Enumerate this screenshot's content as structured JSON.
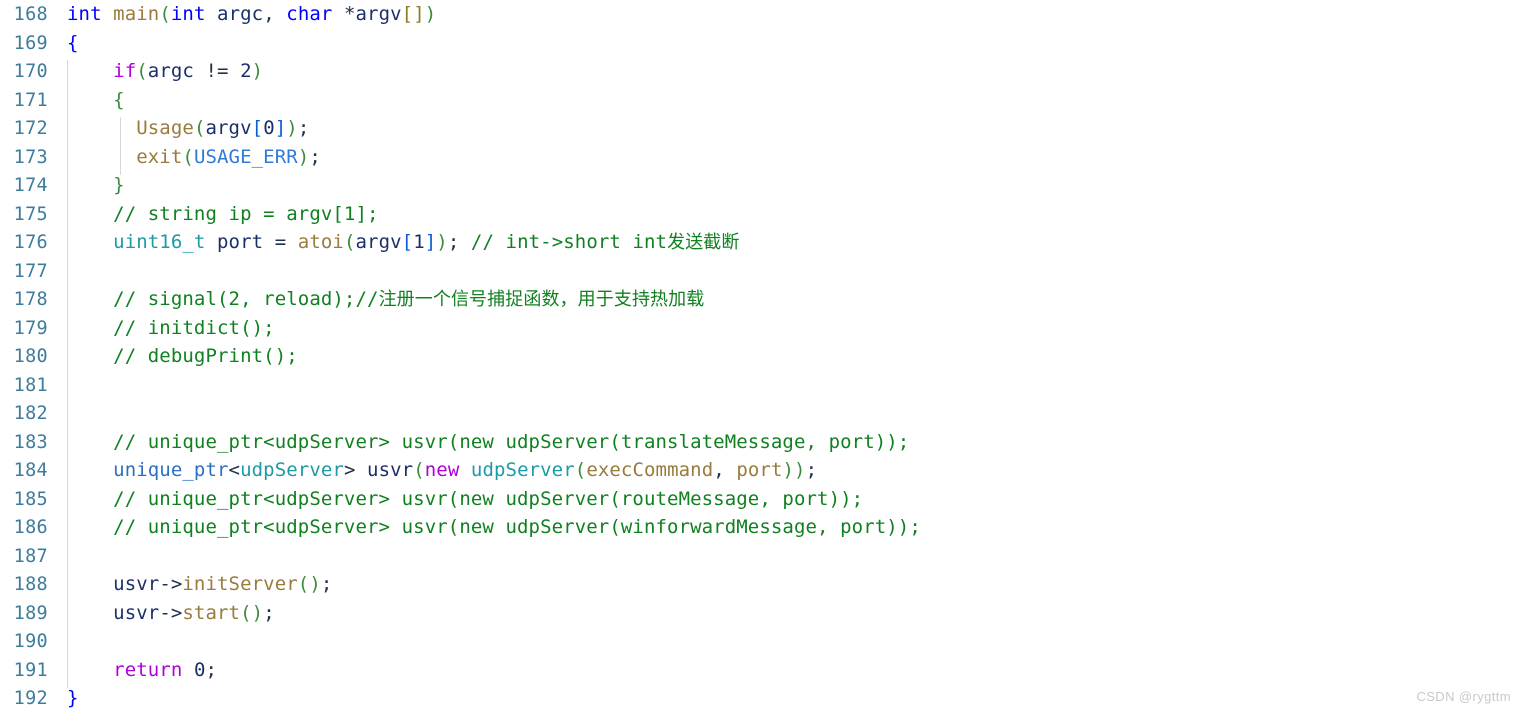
{
  "editor": {
    "language": "cpp",
    "watermark": "CSDN @rygttm",
    "first_line_number": 168,
    "last_line_number": 192,
    "colors": {
      "background": "#ffffff",
      "line_number": "#3f7c9c",
      "keyword": "#0000ff",
      "control_keyword": "#af00db",
      "function": "#977c3c",
      "variable": "#1a2f6b",
      "type": "#1c9aa6",
      "class": "#2b6fc4",
      "macro": "#2f7bd6",
      "comment": "#108020",
      "paren": "#3d8b3d",
      "bracket": "#0b5ed7",
      "brace": "#0000ff",
      "punctuation": "#20304a",
      "indent_guide": "#d8d8d8",
      "watermark": "#c9c9c9"
    }
  },
  "lines": [
    {
      "n": "168",
      "text": "int main(int argc, char *argv[])"
    },
    {
      "n": "169",
      "text": "{"
    },
    {
      "n": "170",
      "text": "    if(argc != 2)"
    },
    {
      "n": "171",
      "text": "    {"
    },
    {
      "n": "172",
      "text": "        Usage(argv[0]);"
    },
    {
      "n": "173",
      "text": "        exit(USAGE_ERR);"
    },
    {
      "n": "174",
      "text": "    }"
    },
    {
      "n": "175",
      "text": "    // string ip = argv[1];"
    },
    {
      "n": "176",
      "text": "    uint16_t port = atoi(argv[1]); // int->short int发送截断"
    },
    {
      "n": "177",
      "text": ""
    },
    {
      "n": "178",
      "text": "    // signal(2, reload);//注册一个信号捕捉函数，用于支持热加载"
    },
    {
      "n": "179",
      "text": "    // initdict();"
    },
    {
      "n": "180",
      "text": "    // debugPrint();"
    },
    {
      "n": "181",
      "text": ""
    },
    {
      "n": "182",
      "text": ""
    },
    {
      "n": "183",
      "text": "    // unique_ptr<udpServer> usvr(new udpServer(translateMessage, port));"
    },
    {
      "n": "184",
      "text": "    unique_ptr<udpServer> usvr(new udpServer(execCommand, port));"
    },
    {
      "n": "185",
      "text": "    // unique_ptr<udpServer> usvr(new udpServer(routeMessage, port));"
    },
    {
      "n": "186",
      "text": "    // unique_ptr<udpServer> usvr(new udpServer(winforwardMessage, port));"
    },
    {
      "n": "187",
      "text": ""
    },
    {
      "n": "188",
      "text": "    usvr->initServer();"
    },
    {
      "n": "189",
      "text": "    usvr->start();"
    },
    {
      "n": "190",
      "text": ""
    },
    {
      "n": "191",
      "text": "    return 0;"
    },
    {
      "n": "192",
      "text": "}"
    }
  ],
  "line_numbers": {
    "l168": "168",
    "l169": "169",
    "l170": "170",
    "l171": "171",
    "l172": "172",
    "l173": "173",
    "l174": "174",
    "l175": "175",
    "l176": "176",
    "l177": "177",
    "l178": "178",
    "l179": "179",
    "l180": "180",
    "l181": "181",
    "l182": "182",
    "l183": "183",
    "l184": "184",
    "l185": "185",
    "l186": "186",
    "l187": "187",
    "l188": "188",
    "l189": "189",
    "l190": "190",
    "l191": "191",
    "l192": "192"
  },
  "tokens": {
    "t168": {
      "kw_int": "int",
      "fn_main": "main",
      "lp": "(",
      "kw_int2": "int",
      "var_argc": "argc",
      "comma": ", ",
      "kw_char": "char",
      "star": " *",
      "var_argv": "argv",
      "empty_brk": "[]",
      "rp": ")"
    },
    "t169": {
      "brace": "{"
    },
    "t170": {
      "kw_if": "if",
      "lp": "(",
      "var_argc": "argc",
      "op": " != ",
      "num2": "2",
      "rp": ")"
    },
    "t171": {
      "brace": "{"
    },
    "t172": {
      "fn_usage": "Usage",
      "lp": "(",
      "var_argv": "argv",
      "lb": "[",
      "num0": "0",
      "rb": "]",
      "rp": ")",
      "semi": ";"
    },
    "t173": {
      "fn_exit": "exit",
      "lp": "(",
      "macro": "USAGE_ERR",
      "rp": ")",
      "semi": ";"
    },
    "t174": {
      "brace": "}"
    },
    "t175": {
      "comment": "// string ip = argv[1];"
    },
    "t176": {
      "type": "uint16_t",
      "var_port": " port",
      "eq": " = ",
      "fn_atoi": "atoi",
      "lp": "(",
      "var_argv": "argv",
      "lb": "[",
      "num1": "1",
      "rb": "]",
      "rp": ")",
      "semi": ";",
      "comment": " // int->short int",
      "comment_cjk": "发送截断"
    },
    "t178": {
      "comment": "// signal(2, reload);//",
      "comment_cjk": "注册一个信号捕捉函数，用于支持热加载"
    },
    "t179": {
      "comment": "// initdict();"
    },
    "t180": {
      "comment": "// debugPrint();"
    },
    "t183": {
      "comment": "// unique_ptr<udpServer> usvr(new udpServer(translateMessage, port));"
    },
    "t184": {
      "cls": "unique_ptr",
      "lt": "<",
      "type": "udpServer",
      "gt": ">",
      "var_usvr": " usvr",
      "lp": "(",
      "kw_new": "new",
      "type2": " udpServer",
      "lp2": "(",
      "arg": "execCommand",
      "comma": ", ",
      "var_port": "port",
      "rp2": ")",
      "rp": ")",
      "semi": ";"
    },
    "t185": {
      "comment": "// unique_ptr<udpServer> usvr(new udpServer(routeMessage, port));"
    },
    "t186": {
      "comment": "// unique_ptr<udpServer> usvr(new udpServer(winforwardMessage, port));"
    },
    "t188": {
      "var_usvr": "usvr",
      "arrow": "->",
      "fn": "initServer",
      "lp": "(",
      "rp": ")",
      "semi": ";"
    },
    "t189": {
      "var_usvr": "usvr",
      "arrow": "->",
      "fn": "start",
      "lp": "(",
      "rp": ")",
      "semi": ";"
    },
    "t191": {
      "kw_return": "return",
      "sp": " ",
      "num0": "0",
      "semi": ";"
    },
    "t192": {
      "brace": "}"
    }
  }
}
